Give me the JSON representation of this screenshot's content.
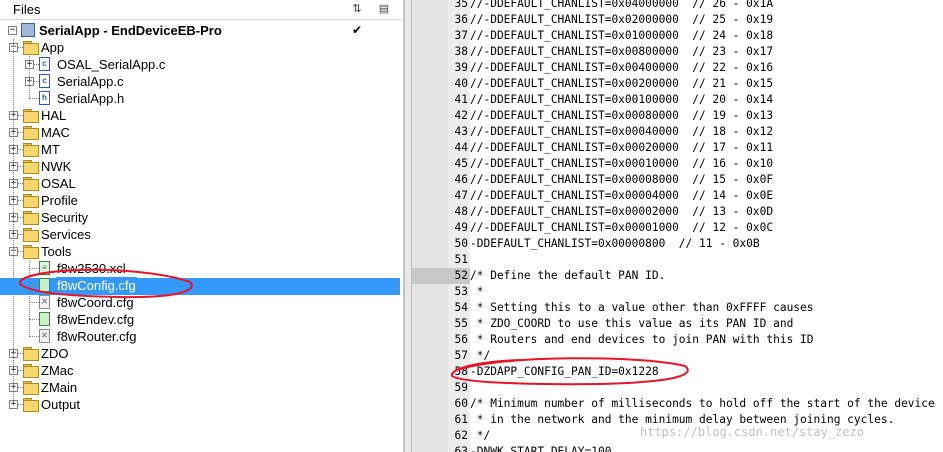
{
  "files_panel": {
    "title": "Files",
    "header_icons": [
      "collapse-all-icon",
      "options-icon"
    ],
    "project": {
      "label": "SerialApp - EndDeviceEB-Pro",
      "checked": "✔"
    },
    "tree": [
      {
        "label": "App",
        "type": "folder",
        "expander": "−",
        "icon": "folder-icon"
      },
      {
        "label": "OSAL_SerialApp.c",
        "type": "c-file",
        "expander": "+",
        "icon": "c-file-icon"
      },
      {
        "label": "SerialApp.c",
        "type": "c-file",
        "expander": "+",
        "icon": "c-file-icon"
      },
      {
        "label": "SerialApp.h",
        "type": "h-file",
        "expander": "",
        "icon": "h-file-icon"
      },
      {
        "label": "HAL",
        "type": "folder",
        "expander": "+",
        "icon": "folder-icon"
      },
      {
        "label": "MAC",
        "type": "folder",
        "expander": "+",
        "icon": "folder-icon"
      },
      {
        "label": "MT",
        "type": "folder",
        "expander": "+",
        "icon": "folder-icon"
      },
      {
        "label": "NWK",
        "type": "folder",
        "expander": "+",
        "icon": "folder-icon"
      },
      {
        "label": "OSAL",
        "type": "folder",
        "expander": "+",
        "icon": "folder-icon"
      },
      {
        "label": "Profile",
        "type": "folder",
        "expander": "+",
        "icon": "folder-icon"
      },
      {
        "label": "Security",
        "type": "folder",
        "expander": "+",
        "icon": "folder-icon"
      },
      {
        "label": "Services",
        "type": "folder",
        "expander": "+",
        "icon": "folder-icon"
      },
      {
        "label": "Tools",
        "type": "folder",
        "expander": "−",
        "icon": "folder-icon"
      },
      {
        "label": "f8w2530.xcl",
        "type": "xcl-file",
        "expander": "",
        "icon": "xcl-file-icon"
      },
      {
        "label": "f8wConfig.cfg",
        "type": "cfg-file",
        "expander": "",
        "icon": "cfg-file-icon",
        "selected": true
      },
      {
        "label": "f8wCoord.cfg",
        "type": "cfg-file",
        "expander": "",
        "icon": "cfg-file-icon"
      },
      {
        "label": "f8wEndev.cfg",
        "type": "cfg-file",
        "expander": "",
        "icon": "cfg-file-icon"
      },
      {
        "label": "f8wRouter.cfg",
        "type": "cfg-file",
        "expander": "",
        "icon": "cfg-file-icon"
      },
      {
        "label": "ZDO",
        "type": "folder",
        "expander": "+",
        "icon": "folder-icon"
      },
      {
        "label": "ZMac",
        "type": "folder",
        "expander": "+",
        "icon": "folder-icon"
      },
      {
        "label": "ZMain",
        "type": "folder",
        "expander": "+",
        "icon": "folder-icon"
      },
      {
        "label": "Output",
        "type": "folder",
        "expander": "+",
        "icon": "folder-icon"
      }
    ]
  },
  "editor": {
    "lines": [
      {
        "num": "35",
        "text": "//-DDEFAULT_CHANLIST=0x04000000  // 26 - 0x1A"
      },
      {
        "num": "36",
        "text": "//-DDEFAULT_CHANLIST=0x02000000  // 25 - 0x19"
      },
      {
        "num": "37",
        "text": "//-DDEFAULT_CHANLIST=0x01000000  // 24 - 0x18"
      },
      {
        "num": "38",
        "text": "//-DDEFAULT_CHANLIST=0x00800000  // 23 - 0x17"
      },
      {
        "num": "39",
        "text": "//-DDEFAULT_CHANLIST=0x00400000  // 22 - 0x16"
      },
      {
        "num": "40",
        "text": "//-DDEFAULT_CHANLIST=0x00200000  // 21 - 0x15"
      },
      {
        "num": "41",
        "text": "//-DDEFAULT_CHANLIST=0x00100000  // 20 - 0x14"
      },
      {
        "num": "42",
        "text": "//-DDEFAULT_CHANLIST=0x00080000  // 19 - 0x13"
      },
      {
        "num": "43",
        "text": "//-DDEFAULT_CHANLIST=0x00040000  // 18 - 0x12"
      },
      {
        "num": "44",
        "text": "//-DDEFAULT_CHANLIST=0x00020000  // 17 - 0x11"
      },
      {
        "num": "45",
        "text": "//-DDEFAULT_CHANLIST=0x00010000  // 16 - 0x10"
      },
      {
        "num": "46",
        "text": "//-DDEFAULT_CHANLIST=0x00008000  // 15 - 0x0F"
      },
      {
        "num": "47",
        "text": "//-DDEFAULT_CHANLIST=0x00004000  // 14 - 0x0E"
      },
      {
        "num": "48",
        "text": "//-DDEFAULT_CHANLIST=0x00002000  // 13 - 0x0D"
      },
      {
        "num": "49",
        "text": "//-DDEFAULT_CHANLIST=0x00001000  // 12 - 0x0C"
      },
      {
        "num": "50",
        "text": "-DDEFAULT_CHANLIST=0x00000800  // 11 - 0x0B"
      },
      {
        "num": "51",
        "text": ""
      },
      {
        "num": "52",
        "text": "/* Define the default PAN ID.",
        "current": true
      },
      {
        "num": "53",
        "text": " *"
      },
      {
        "num": "54",
        "text": " * Setting this to a value other than 0xFFFF causes"
      },
      {
        "num": "55",
        "text": " * ZDO_COORD to use this value as its PAN ID and"
      },
      {
        "num": "56",
        "text": " * Routers and end devices to join PAN with this ID"
      },
      {
        "num": "57",
        "text": " */"
      },
      {
        "num": "58",
        "text": "-DZDAPP_CONFIG_PAN_ID=0x1228"
      },
      {
        "num": "59",
        "text": ""
      },
      {
        "num": "60",
        "text": "/* Minimum number of milliseconds to hold off the start of the device"
      },
      {
        "num": "61",
        "text": " * in the network and the minimum delay between joining cycles."
      },
      {
        "num": "62",
        "text": " */"
      },
      {
        "num": "63",
        "text": "-DNWK_START_DELAY=100"
      }
    ]
  },
  "watermark": "https://blog.csdn.net/stay_zezo",
  "annotation_color": "#e8142a"
}
